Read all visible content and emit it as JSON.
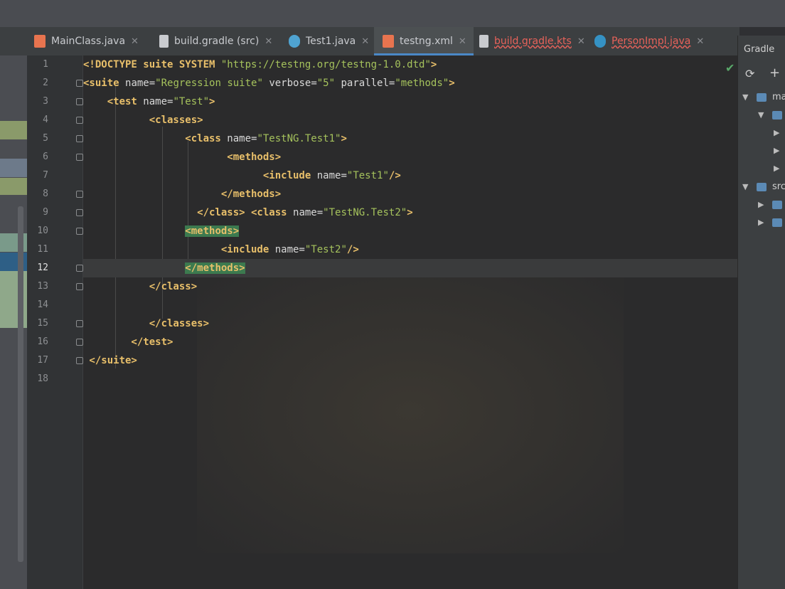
{
  "tabs": [
    {
      "label": "MainClass.java",
      "icon": "java-class-icon",
      "color": "#e8744f"
    },
    {
      "label": "build.gradle (src)",
      "icon": "gradle-file-icon",
      "color": "#c9cbcf"
    },
    {
      "label": "Test1.java",
      "icon": "test-class-icon",
      "color": "#4fa3d1"
    },
    {
      "label": "testng.xml",
      "icon": "xml-file-icon",
      "color": "#e8744f"
    },
    {
      "label": "build.gradle.kts",
      "icon": "kotlin-script-icon",
      "color": "#c9cbcf"
    },
    {
      "label": "PersonImpl.java",
      "icon": "class-icon",
      "color": "#3592c4"
    }
  ],
  "gradle_panel": {
    "title": "Gradle",
    "items": [
      "ma",
      "src"
    ]
  },
  "code_lines": [
    {
      "n": "1",
      "segs": [
        [
          "tag",
          "<!DOCTYPE suite SYSTEM "
        ],
        [
          "val",
          "\"https://testng.org/testng-1.0.dtd\""
        ],
        [
          "tag",
          ">"
        ]
      ]
    },
    {
      "n": "2",
      "segs": [
        [
          "tag",
          "<suite "
        ],
        [
          "attr",
          "name="
        ],
        [
          "val",
          "\"Regression suite\""
        ],
        [
          "attr",
          " verbose="
        ],
        [
          "val",
          "\"5\""
        ],
        [
          "attr",
          " parallel="
        ],
        [
          "val",
          "\"methods\""
        ],
        [
          "tag",
          ">"
        ]
      ]
    },
    {
      "n": "3",
      "segs": [
        [
          "tag",
          "    <test "
        ],
        [
          "attr",
          "name="
        ],
        [
          "val",
          "\"Test\""
        ],
        [
          "tag",
          ">"
        ]
      ]
    },
    {
      "n": "4",
      "segs": [
        [
          "tag",
          "           <classes>"
        ]
      ]
    },
    {
      "n": "5",
      "segs": [
        [
          "tag",
          "                 <class "
        ],
        [
          "attr",
          "name="
        ],
        [
          "val",
          "\"TestNG.Test1\""
        ],
        [
          "tag",
          ">"
        ]
      ]
    },
    {
      "n": "6",
      "segs": [
        [
          "tag",
          "                        <methods>"
        ]
      ]
    },
    {
      "n": "7",
      "segs": [
        [
          "tag",
          "                              <include "
        ],
        [
          "attr",
          "name="
        ],
        [
          "val",
          "\"Test1\""
        ],
        [
          "tag",
          "/>"
        ]
      ]
    },
    {
      "n": "8",
      "segs": [
        [
          "tag",
          "                       </methods>"
        ]
      ]
    },
    {
      "n": "9",
      "segs": [
        [
          "tag",
          "                   </class> <class "
        ],
        [
          "attr",
          "name="
        ],
        [
          "val",
          "\"TestNG.Test2\""
        ],
        [
          "tag",
          ">"
        ]
      ]
    },
    {
      "n": "10",
      "segs": [
        [
          "tag",
          "                 "
        ],
        [
          "hl",
          "<methods>"
        ]
      ]
    },
    {
      "n": "11",
      "segs": [
        [
          "tag",
          "                       <include "
        ],
        [
          "attr",
          "name="
        ],
        [
          "val",
          "\"Test2\""
        ],
        [
          "tag",
          "/>"
        ]
      ]
    },
    {
      "n": "12",
      "segs": [
        [
          "tag",
          "                 "
        ],
        [
          "hl",
          "</methods>"
        ]
      ]
    },
    {
      "n": "13",
      "segs": [
        [
          "tag",
          "           </class>"
        ]
      ]
    },
    {
      "n": "14",
      "segs": []
    },
    {
      "n": "15",
      "segs": [
        [
          "tag",
          "           </classes>"
        ]
      ]
    },
    {
      "n": "16",
      "segs": [
        [
          "tag",
          "        </test>"
        ]
      ]
    },
    {
      "n": "17",
      "segs": [
        [
          "tag",
          " </suite>"
        ]
      ]
    },
    {
      "n": "18",
      "segs": []
    }
  ],
  "current_line": "12"
}
